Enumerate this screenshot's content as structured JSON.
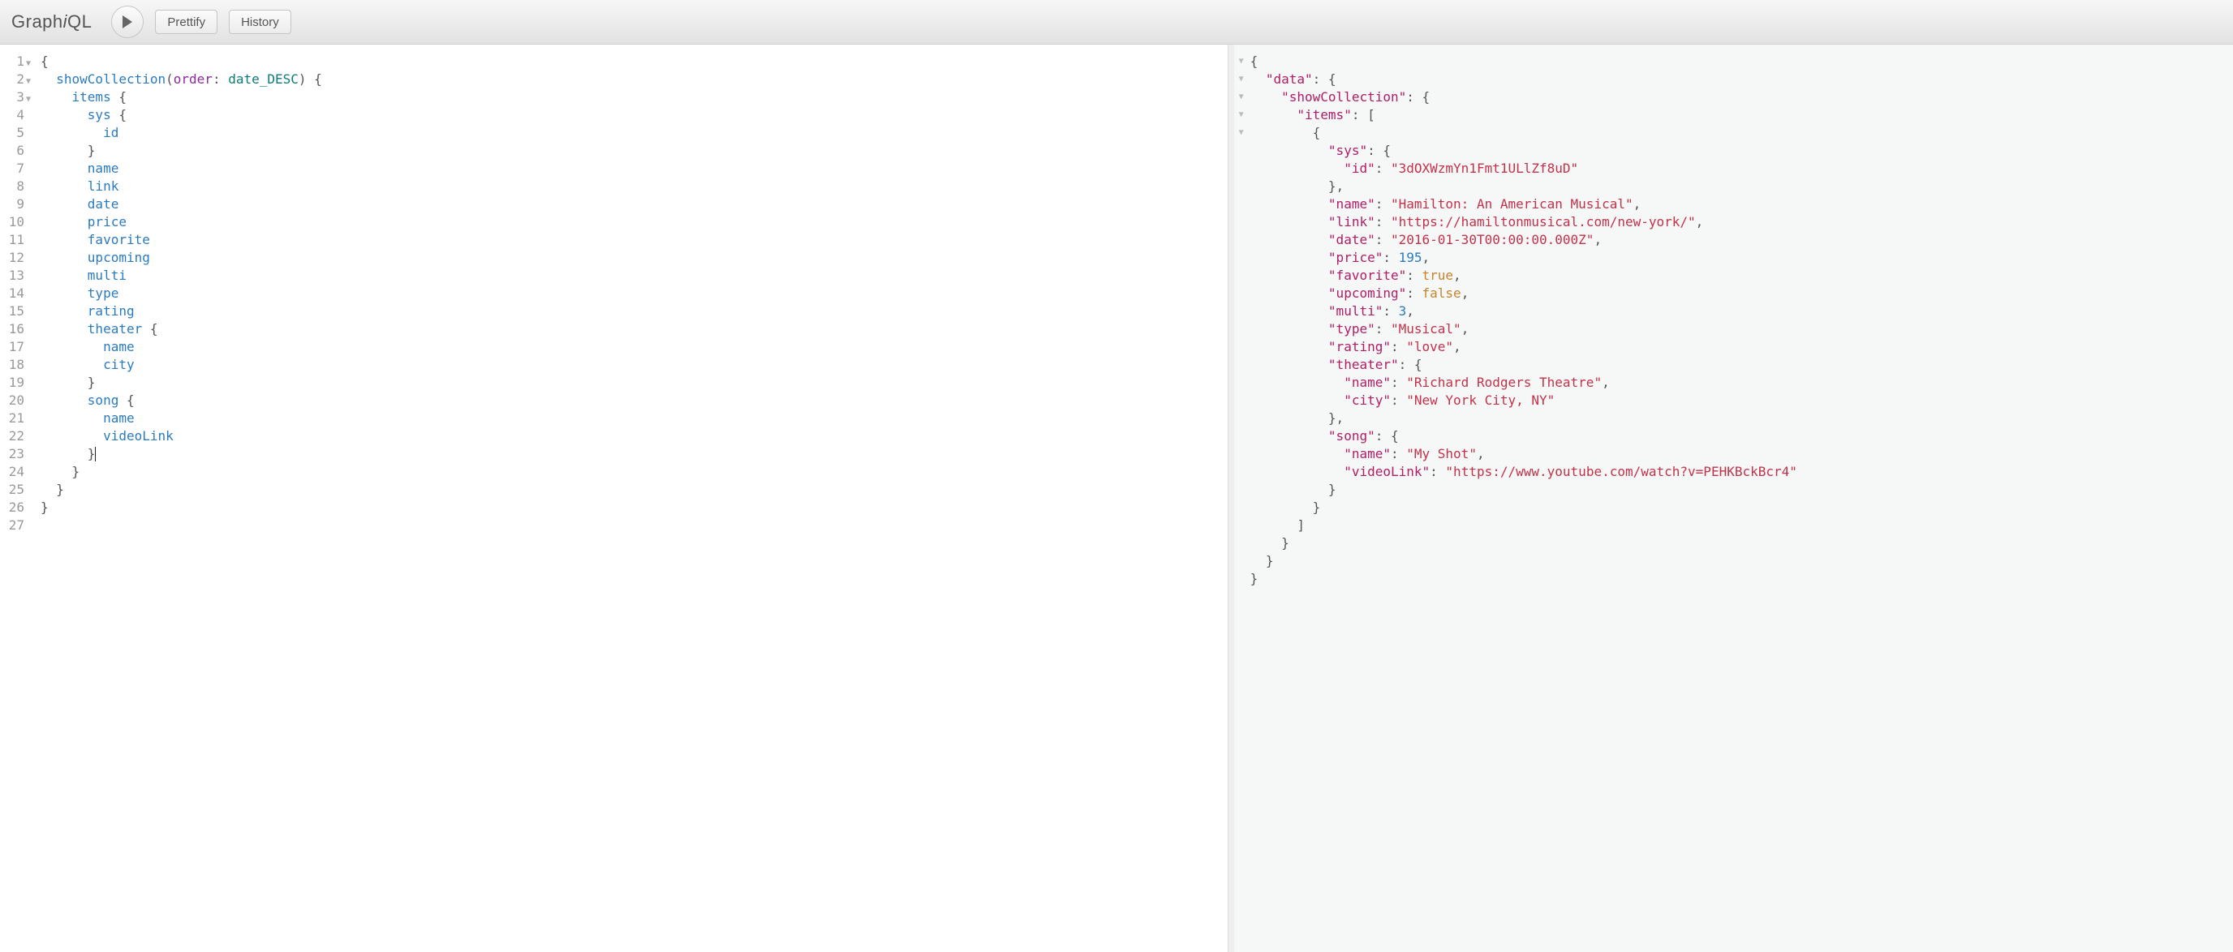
{
  "app": {
    "name": "GraphiQL"
  },
  "toolbar": {
    "prettify": "Prettify",
    "history": "History"
  },
  "query": {
    "lines": [
      {
        "n": 1,
        "fold": true,
        "tokens": [
          {
            "t": "{",
            "c": "punct"
          }
        ]
      },
      {
        "n": 2,
        "fold": true,
        "tokens": [
          {
            "t": "  "
          },
          {
            "t": "showCollection",
            "c": "field"
          },
          {
            "t": "("
          },
          {
            "t": "order",
            "c": "arg"
          },
          {
            "t": ": "
          },
          {
            "t": "date_DESC",
            "c": "enum"
          },
          {
            "t": ") {"
          }
        ]
      },
      {
        "n": 3,
        "fold": true,
        "tokens": [
          {
            "t": "    "
          },
          {
            "t": "items",
            "c": "field"
          },
          {
            "t": " {"
          }
        ]
      },
      {
        "n": 4,
        "fold": false,
        "tokens": [
          {
            "t": "      "
          },
          {
            "t": "sys",
            "c": "field"
          },
          {
            "t": " {"
          }
        ]
      },
      {
        "n": 5,
        "fold": false,
        "tokens": [
          {
            "t": "        "
          },
          {
            "t": "id",
            "c": "field"
          }
        ]
      },
      {
        "n": 6,
        "fold": false,
        "tokens": [
          {
            "t": "      }"
          }
        ]
      },
      {
        "n": 7,
        "fold": false,
        "tokens": [
          {
            "t": "      "
          },
          {
            "t": "name",
            "c": "field"
          }
        ]
      },
      {
        "n": 8,
        "fold": false,
        "tokens": [
          {
            "t": "      "
          },
          {
            "t": "link",
            "c": "field"
          }
        ]
      },
      {
        "n": 9,
        "fold": false,
        "tokens": [
          {
            "t": "      "
          },
          {
            "t": "date",
            "c": "field"
          }
        ]
      },
      {
        "n": 10,
        "fold": false,
        "tokens": [
          {
            "t": "      "
          },
          {
            "t": "price",
            "c": "field"
          }
        ]
      },
      {
        "n": 11,
        "fold": false,
        "tokens": [
          {
            "t": "      "
          },
          {
            "t": "favorite",
            "c": "field"
          }
        ]
      },
      {
        "n": 12,
        "fold": false,
        "tokens": [
          {
            "t": "      "
          },
          {
            "t": "upcoming",
            "c": "field"
          }
        ]
      },
      {
        "n": 13,
        "fold": false,
        "tokens": [
          {
            "t": "      "
          },
          {
            "t": "multi",
            "c": "field"
          }
        ]
      },
      {
        "n": 14,
        "fold": false,
        "tokens": [
          {
            "t": "      "
          },
          {
            "t": "type",
            "c": "field"
          }
        ]
      },
      {
        "n": 15,
        "fold": false,
        "tokens": [
          {
            "t": "      "
          },
          {
            "t": "rating",
            "c": "field"
          }
        ]
      },
      {
        "n": 16,
        "fold": false,
        "tokens": [
          {
            "t": "      "
          },
          {
            "t": "theater",
            "c": "field"
          },
          {
            "t": " {"
          }
        ]
      },
      {
        "n": 17,
        "fold": false,
        "tokens": [
          {
            "t": "        "
          },
          {
            "t": "name",
            "c": "field"
          }
        ]
      },
      {
        "n": 18,
        "fold": false,
        "tokens": [
          {
            "t": "        "
          },
          {
            "t": "city",
            "c": "field"
          }
        ]
      },
      {
        "n": 19,
        "fold": false,
        "tokens": [
          {
            "t": "      }"
          }
        ]
      },
      {
        "n": 20,
        "fold": false,
        "tokens": [
          {
            "t": "      "
          },
          {
            "t": "song",
            "c": "field"
          },
          {
            "t": " {"
          }
        ]
      },
      {
        "n": 21,
        "fold": false,
        "tokens": [
          {
            "t": "        "
          },
          {
            "t": "name",
            "c": "field"
          }
        ]
      },
      {
        "n": 22,
        "fold": false,
        "tokens": [
          {
            "t": "        "
          },
          {
            "t": "videoLink",
            "c": "field"
          }
        ]
      },
      {
        "n": 23,
        "fold": false,
        "tokens": [
          {
            "t": "      }"
          }
        ],
        "cursor": true
      },
      {
        "n": 24,
        "fold": false,
        "tokens": [
          {
            "t": "    }"
          }
        ]
      },
      {
        "n": 25,
        "fold": false,
        "tokens": [
          {
            "t": "  }"
          }
        ]
      },
      {
        "n": 26,
        "fold": false,
        "tokens": [
          {
            "t": "}"
          }
        ]
      },
      {
        "n": 27,
        "fold": false,
        "tokens": [
          {
            "t": ""
          }
        ]
      }
    ]
  },
  "result": {
    "foldRows": 5,
    "lines": [
      [
        {
          "t": "{",
          "c": "punct"
        }
      ],
      [
        {
          "t": "  "
        },
        {
          "t": "\"data\"",
          "c": "key"
        },
        {
          "t": ": {",
          "c": "punct"
        }
      ],
      [
        {
          "t": "    "
        },
        {
          "t": "\"showCollection\"",
          "c": "key"
        },
        {
          "t": ": {",
          "c": "punct"
        }
      ],
      [
        {
          "t": "      "
        },
        {
          "t": "\"items\"",
          "c": "key"
        },
        {
          "t": ": [",
          "c": "punct"
        }
      ],
      [
        {
          "t": "        {",
          "c": "punct"
        }
      ],
      [
        {
          "t": "          "
        },
        {
          "t": "\"sys\"",
          "c": "key"
        },
        {
          "t": ": {",
          "c": "punct"
        }
      ],
      [
        {
          "t": "            "
        },
        {
          "t": "\"id\"",
          "c": "key"
        },
        {
          "t": ": ",
          "c": "punct"
        },
        {
          "t": "\"3dOXWzmYn1Fmt1ULlZf8uD\"",
          "c": "str"
        }
      ],
      [
        {
          "t": "          },",
          "c": "punct"
        }
      ],
      [
        {
          "t": "          "
        },
        {
          "t": "\"name\"",
          "c": "key"
        },
        {
          "t": ": ",
          "c": "punct"
        },
        {
          "t": "\"Hamilton: An American Musical\"",
          "c": "str"
        },
        {
          "t": ",",
          "c": "punct"
        }
      ],
      [
        {
          "t": "          "
        },
        {
          "t": "\"link\"",
          "c": "key"
        },
        {
          "t": ": ",
          "c": "punct"
        },
        {
          "t": "\"https://hamiltonmusical.com/new-york/\"",
          "c": "str"
        },
        {
          "t": ",",
          "c": "punct"
        }
      ],
      [
        {
          "t": "          "
        },
        {
          "t": "\"date\"",
          "c": "key"
        },
        {
          "t": ": ",
          "c": "punct"
        },
        {
          "t": "\"2016-01-30T00:00:00.000Z\"",
          "c": "str"
        },
        {
          "t": ",",
          "c": "punct"
        }
      ],
      [
        {
          "t": "          "
        },
        {
          "t": "\"price\"",
          "c": "key"
        },
        {
          "t": ": ",
          "c": "punct"
        },
        {
          "t": "195",
          "c": "num"
        },
        {
          "t": ",",
          "c": "punct"
        }
      ],
      [
        {
          "t": "          "
        },
        {
          "t": "\"favorite\"",
          "c": "key"
        },
        {
          "t": ": ",
          "c": "punct"
        },
        {
          "t": "true",
          "c": "bool"
        },
        {
          "t": ",",
          "c": "punct"
        }
      ],
      [
        {
          "t": "          "
        },
        {
          "t": "\"upcoming\"",
          "c": "key"
        },
        {
          "t": ": ",
          "c": "punct"
        },
        {
          "t": "false",
          "c": "bool"
        },
        {
          "t": ",",
          "c": "punct"
        }
      ],
      [
        {
          "t": "          "
        },
        {
          "t": "\"multi\"",
          "c": "key"
        },
        {
          "t": ": ",
          "c": "punct"
        },
        {
          "t": "3",
          "c": "num"
        },
        {
          "t": ",",
          "c": "punct"
        }
      ],
      [
        {
          "t": "          "
        },
        {
          "t": "\"type\"",
          "c": "key"
        },
        {
          "t": ": ",
          "c": "punct"
        },
        {
          "t": "\"Musical\"",
          "c": "str"
        },
        {
          "t": ",",
          "c": "punct"
        }
      ],
      [
        {
          "t": "          "
        },
        {
          "t": "\"rating\"",
          "c": "key"
        },
        {
          "t": ": ",
          "c": "punct"
        },
        {
          "t": "\"love\"",
          "c": "str"
        },
        {
          "t": ",",
          "c": "punct"
        }
      ],
      [
        {
          "t": "          "
        },
        {
          "t": "\"theater\"",
          "c": "key"
        },
        {
          "t": ": {",
          "c": "punct"
        }
      ],
      [
        {
          "t": "            "
        },
        {
          "t": "\"name\"",
          "c": "key"
        },
        {
          "t": ": ",
          "c": "punct"
        },
        {
          "t": "\"Richard Rodgers Theatre\"",
          "c": "str"
        },
        {
          "t": ",",
          "c": "punct"
        }
      ],
      [
        {
          "t": "            "
        },
        {
          "t": "\"city\"",
          "c": "key"
        },
        {
          "t": ": ",
          "c": "punct"
        },
        {
          "t": "\"New York City, NY\"",
          "c": "str"
        }
      ],
      [
        {
          "t": "          },",
          "c": "punct"
        }
      ],
      [
        {
          "t": "          "
        },
        {
          "t": "\"song\"",
          "c": "key"
        },
        {
          "t": ": {",
          "c": "punct"
        }
      ],
      [
        {
          "t": "            "
        },
        {
          "t": "\"name\"",
          "c": "key"
        },
        {
          "t": ": ",
          "c": "punct"
        },
        {
          "t": "\"My Shot\"",
          "c": "str"
        },
        {
          "t": ",",
          "c": "punct"
        }
      ],
      [
        {
          "t": "            "
        },
        {
          "t": "\"videoLink\"",
          "c": "key"
        },
        {
          "t": ": ",
          "c": "punct"
        },
        {
          "t": "\"https://www.youtube.com/watch?v=PEHKBckBcr4\"",
          "c": "str"
        }
      ],
      [
        {
          "t": "          }",
          "c": "punct"
        }
      ],
      [
        {
          "t": "        }",
          "c": "punct"
        }
      ],
      [
        {
          "t": "      ]",
          "c": "punct"
        }
      ],
      [
        {
          "t": "    }",
          "c": "punct"
        }
      ],
      [
        {
          "t": "  }",
          "c": "punct"
        }
      ],
      [
        {
          "t": "}",
          "c": "punct"
        }
      ]
    ]
  }
}
